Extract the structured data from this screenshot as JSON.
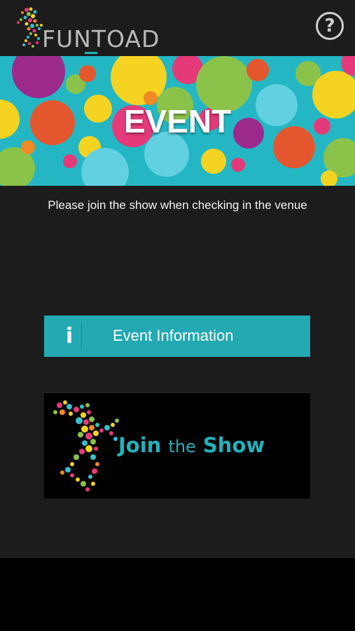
{
  "header": {
    "brand": "FUNTOAD",
    "help_symbol": "?"
  },
  "banner": {
    "title": "EVENT"
  },
  "subtitle": "Please join the show when checking in the venue",
  "event_info_button": {
    "icon_symbol": "i",
    "label": "Event Information"
  },
  "join_show_button": {
    "label_part1": "Join",
    "label_part2": "the",
    "label_part3": "Show"
  },
  "colors": {
    "background": "#1c1c1c",
    "accent_teal": "#22a9b2",
    "brand_grey": "#b9b9b9"
  },
  "icons": {
    "help": "help-question-icon",
    "info": "info-icon",
    "logo": "frog-logo-icon"
  }
}
